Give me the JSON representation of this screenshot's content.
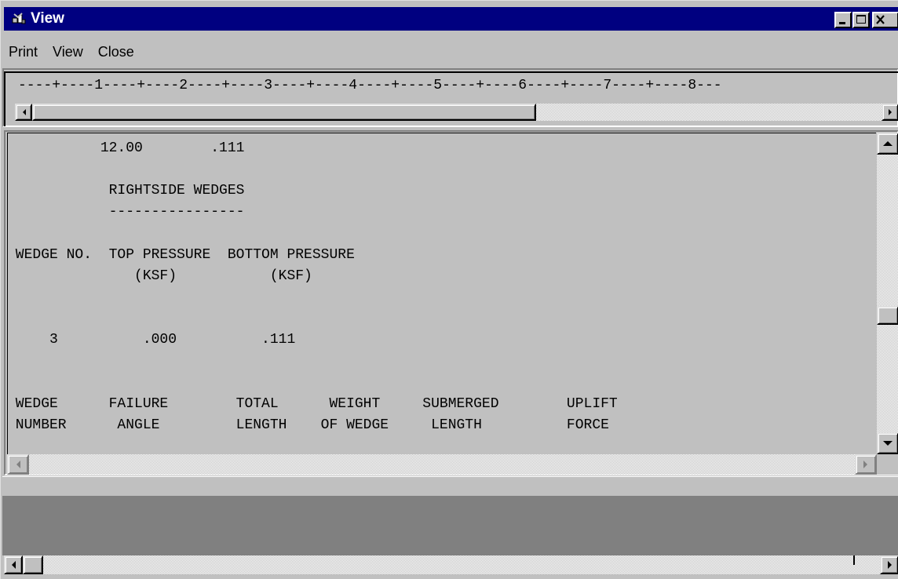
{
  "window": {
    "title": "View",
    "app_icon": "app-icon",
    "controls": [
      "minimize-icon",
      "maximize-icon",
      "close-icon"
    ],
    "colors": {
      "titlebar": "#000080",
      "face": "#c0c0c0",
      "workspace": "#808080"
    }
  },
  "menu": {
    "items": [
      {
        "label": "Print"
      },
      {
        "label": "View"
      },
      {
        "label": "Close"
      }
    ]
  },
  "ruler": {
    "text": "----+----1----+----2----+----3----+----4----+----5----+----6----+----7----+----8---"
  },
  "report": {
    "lines": [
      "           12.00        .111",
      "",
      "            RIGHTSIDE WEDGES",
      "            ----------------",
      "",
      " WEDGE NO.  TOP PRESSURE  BOTTOM PRESSURE",
      "               (KSF)           (KSF)",
      "",
      "",
      "     3          .000          .111",
      "",
      "",
      " WEDGE      FAILURE        TOTAL      WEIGHT     SUBMERGED        UPLIFT",
      " NUMBER      ANGLE         LENGTH    OF WEDGE     LENGTH          FORCE"
    ]
  },
  "scrollbars": {
    "ruler_horizontal": {
      "position": 0.0,
      "visible_fraction": 0.62
    },
    "report_vertical": {
      "position": 0.62
    },
    "report_horizontal": {
      "position": 0.0
    },
    "bottom_horizontal": {
      "position": 0.0
    }
  }
}
